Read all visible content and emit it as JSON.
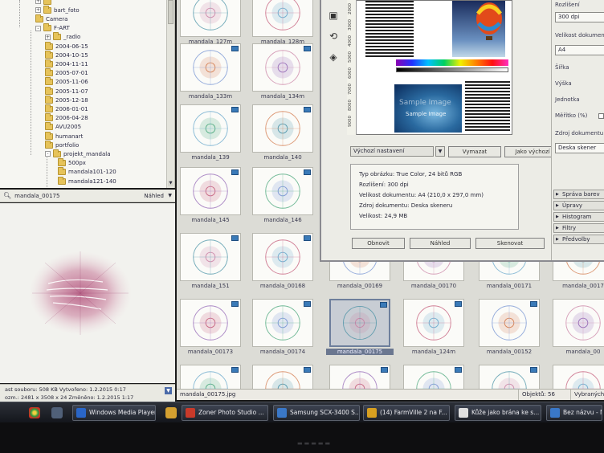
{
  "tree": {
    "items": [
      {
        "label": "",
        "depth": 1,
        "expander": "+"
      },
      {
        "label": "bart_foto",
        "depth": 1,
        "expander": "+"
      },
      {
        "label": "Camera",
        "depth": 1,
        "expander": ""
      },
      {
        "label": "F-ART",
        "depth": 1,
        "expander": "-"
      },
      {
        "label": "_radio",
        "depth": 2,
        "expander": "+"
      },
      {
        "label": "2004-06-15",
        "depth": 2,
        "expander": ""
      },
      {
        "label": "2004-10-15",
        "depth": 2,
        "expander": ""
      },
      {
        "label": "2004-11-11",
        "depth": 2,
        "expander": ""
      },
      {
        "label": "2005-07-01",
        "depth": 2,
        "expander": ""
      },
      {
        "label": "2005-11-06",
        "depth": 2,
        "expander": ""
      },
      {
        "label": "2005-11-07",
        "depth": 2,
        "expander": ""
      },
      {
        "label": "2005-12-18",
        "depth": 2,
        "expander": ""
      },
      {
        "label": "2006-01-01",
        "depth": 2,
        "expander": ""
      },
      {
        "label": "2006-04-28",
        "depth": 2,
        "expander": ""
      },
      {
        "label": "AVU2005",
        "depth": 2,
        "expander": ""
      },
      {
        "label": "humanart",
        "depth": 2,
        "expander": ""
      },
      {
        "label": "portfolio",
        "depth": 2,
        "expander": ""
      },
      {
        "label": "projekt_mandala",
        "depth": 2,
        "expander": "-"
      },
      {
        "label": "500px",
        "depth": 3,
        "expander": ""
      },
      {
        "label": "mandala101-120",
        "depth": 3,
        "expander": ""
      },
      {
        "label": "mandala121-140",
        "depth": 3,
        "expander": ""
      }
    ]
  },
  "preview": {
    "filename": "mandala_00175",
    "mode": "Náhled",
    "status_line1": "ast souboru: 508 KB   Vytvořeno: 1.2.2015 0:17",
    "status_line2": "ozm.: 2481 x 3508 x 24   Změněno: 1.2.2015 1:17"
  },
  "thumbnails": [
    {
      "label": "mandala_127m",
      "col": 0,
      "row": 0
    },
    {
      "label": "mandala_128m",
      "col": 1,
      "row": 0
    },
    {
      "label": "mandala_133m",
      "col": 0,
      "row": 1
    },
    {
      "label": "mandala_134m",
      "col": 1,
      "row": 1
    },
    {
      "label": "mandala_139",
      "col": 0,
      "row": 2
    },
    {
      "label": "mandala_140",
      "col": 1,
      "row": 2
    },
    {
      "label": "mandala_145",
      "col": 0,
      "row": 3
    },
    {
      "label": "mandala_146",
      "col": 1,
      "row": 3
    },
    {
      "label": "mandala_151",
      "col": 0,
      "row": 4
    },
    {
      "label": "mandala_00168",
      "col": 1,
      "row": 4
    },
    {
      "label": "mandala_00169",
      "col": 2,
      "row": 4
    },
    {
      "label": "mandala_00170",
      "col": 3,
      "row": 4
    },
    {
      "label": "mandala_00171",
      "col": 4,
      "row": 4
    },
    {
      "label": "mandala_0017",
      "col": 5,
      "row": 4
    },
    {
      "label": "mandala_00173",
      "col": 0,
      "row": 5
    },
    {
      "label": "mandala_00174",
      "col": 1,
      "row": 5
    },
    {
      "label": "mandala_00175",
      "col": 2,
      "row": 5,
      "selected": true
    },
    {
      "label": "mandala_124m",
      "col": 3,
      "row": 5
    },
    {
      "label": "mandala_00152",
      "col": 4,
      "row": 5
    },
    {
      "label": "mandala_00",
      "col": 5,
      "row": 5
    },
    {
      "label": "",
      "col": 0,
      "row": 6
    },
    {
      "label": "",
      "col": 1,
      "row": 6
    },
    {
      "label": "",
      "col": 2,
      "row": 6
    },
    {
      "label": "",
      "col": 3,
      "row": 6
    },
    {
      "label": "",
      "col": 4,
      "row": 6
    },
    {
      "label": "",
      "col": 5,
      "row": 6
    }
  ],
  "grid_status": {
    "filename": "mandala_00175.jpg",
    "objects": "Objektů: 56",
    "selected": "Vybraných ob"
  },
  "scanner": {
    "ruler_labels": [
      "2000",
      "3000",
      "4000",
      "5000",
      "6000",
      "7000",
      "8000",
      "9000"
    ],
    "sample_text": "Sample Image",
    "preset": "Výchozí nastavení",
    "delete_btn": "Vymazat",
    "default_btn": "Jako výchozí",
    "info": [
      "Typ obrázku: True Color, 24 bitů RGB",
      "Rozlišení: 300 dpi",
      "Velikost dokumentu: A4 (210,0 x 297,0 mm)",
      "Zdroj dokumentu: Deska skeneru",
      "Velikost: 24,9 MB"
    ],
    "refresh_btn": "Obnovit",
    "preview_btn": "Náhled",
    "scan_btn": "Skenovat",
    "right": {
      "resolution_label": "Rozlišení",
      "resolution_value": "300 dpi",
      "docsize_label": "Velikost dokumentu",
      "docsize_value": "A4",
      "width_label": "Šířka",
      "height_label": "Výška",
      "unit_label": "Jednotka",
      "scale_label": "Měřítko (%)",
      "source_label": "Zdroj dokumentu",
      "source_value": "Deska skener",
      "menus": [
        "Správa barev",
        "Úpravy",
        "Histogram",
        "Filtry",
        "Předvolby"
      ]
    }
  },
  "taskbar": {
    "items": [
      {
        "label": "Windows Media Player",
        "color": "#2a66c8"
      },
      {
        "label": "Zoner Photo Studio ...",
        "color": "#c83a2a"
      },
      {
        "label": "Samsung SCX-3400 S...",
        "color": "#3a78c8"
      },
      {
        "label": "(14) FarmVille 2 na F...",
        "color": "#d8a020"
      },
      {
        "label": "Kůže jako brána ke s...",
        "color": "#e0e0e0"
      },
      {
        "label": "Bez názvu - Ma",
        "color": "#3a78c8"
      }
    ]
  },
  "colors": {
    "accent": "#6b7790",
    "thumb_badge": "#3a7ab8",
    "folder": "#e6c35a"
  }
}
